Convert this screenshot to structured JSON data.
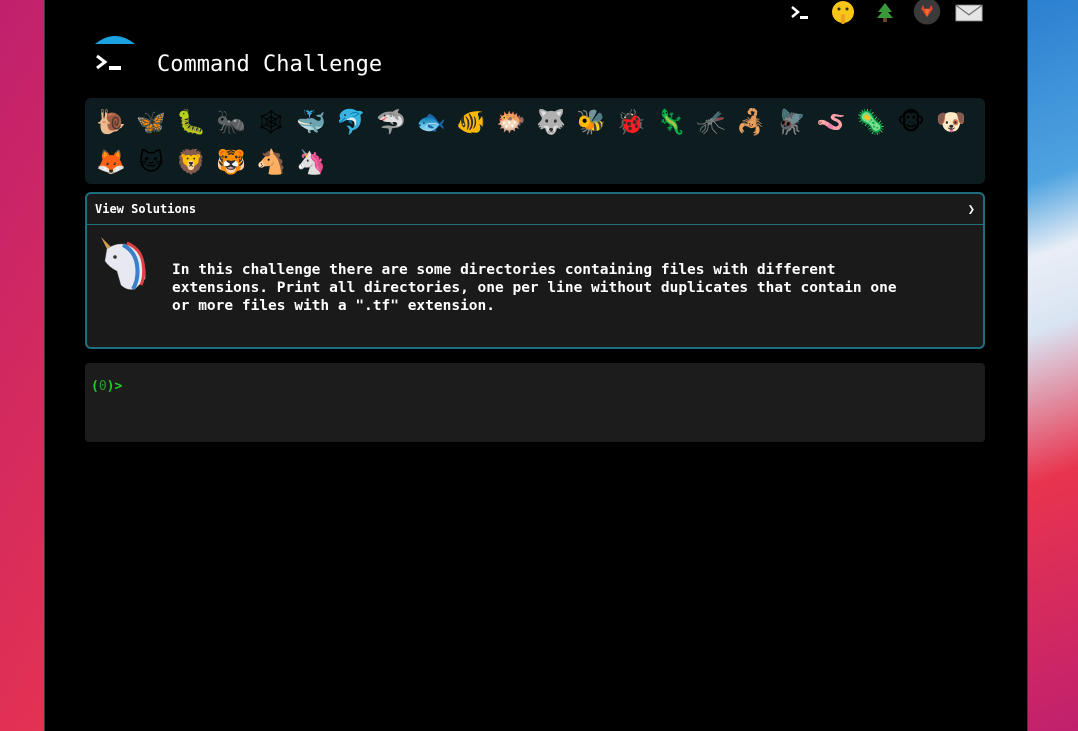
{
  "app": {
    "title": "Command Challenge"
  },
  "top_icons": [
    {
      "name": "terminal-icon",
      "glyph": "›_"
    },
    {
      "name": "shushing-face-icon",
      "glyph": "🤫"
    },
    {
      "name": "tree-icon",
      "glyph": "🌲"
    },
    {
      "name": "gitlab-icon",
      "glyph": "🦊"
    },
    {
      "name": "mail-icon",
      "glyph": "✉"
    }
  ],
  "emojis": [
    {
      "name": "snail-icon",
      "glyph": "🐌"
    },
    {
      "name": "butterfly-icon",
      "glyph": "🦋"
    },
    {
      "name": "caterpillar-icon",
      "glyph": "🐛"
    },
    {
      "name": "ant-icon",
      "glyph": "🐜"
    },
    {
      "name": "spider-web-icon",
      "glyph": "🕸"
    },
    {
      "name": "whale-icon",
      "glyph": "🐳"
    },
    {
      "name": "dolphin-icon",
      "glyph": "🐬"
    },
    {
      "name": "shark-icon",
      "glyph": "🦈"
    },
    {
      "name": "fish-icon",
      "glyph": "🐟"
    },
    {
      "name": "tropical-fish-icon",
      "glyph": "🐠"
    },
    {
      "name": "blowfish-icon",
      "glyph": "🐡"
    },
    {
      "name": "wolf-icon",
      "glyph": "🐺"
    },
    {
      "name": "bee-icon",
      "glyph": "🐝"
    },
    {
      "name": "ladybug-icon",
      "glyph": "🐞"
    },
    {
      "name": "lizard-icon",
      "glyph": "🦎"
    },
    {
      "name": "mosquito-icon",
      "glyph": "🦟"
    },
    {
      "name": "scorpion-icon",
      "glyph": "🦂"
    },
    {
      "name": "fly-icon",
      "glyph": "🪰"
    },
    {
      "name": "worm-icon",
      "glyph": "🪱"
    },
    {
      "name": "microbe-icon",
      "glyph": "🦠"
    },
    {
      "name": "monkey-icon",
      "glyph": "🐵"
    },
    {
      "name": "dog-icon",
      "glyph": "🐶"
    },
    {
      "name": "fox-icon",
      "glyph": "🦊"
    },
    {
      "name": "cat-icon",
      "glyph": "🐱"
    },
    {
      "name": "lion-icon",
      "glyph": "🦁"
    },
    {
      "name": "tiger-icon",
      "glyph": "🐯"
    },
    {
      "name": "horse-icon",
      "glyph": "🐴"
    },
    {
      "name": "unicorn-icon",
      "glyph": "🦄"
    }
  ],
  "panel": {
    "header_label": "View Solutions",
    "chevron": "❯",
    "challenge_text": "In this challenge there are some directories containing files with different\nextensions. Print all directories, one per line without duplicates that contain one\nor more files with a \".tf\" extension."
  },
  "terminal": {
    "prompt_open": "(",
    "prompt_count": "0",
    "prompt_close": ")>",
    "input_value": ""
  },
  "colors": {
    "accent_border": "#1e6e7e",
    "prompt_green": "#22cc22",
    "emoji_bar_bg": "#0d1c1f"
  }
}
